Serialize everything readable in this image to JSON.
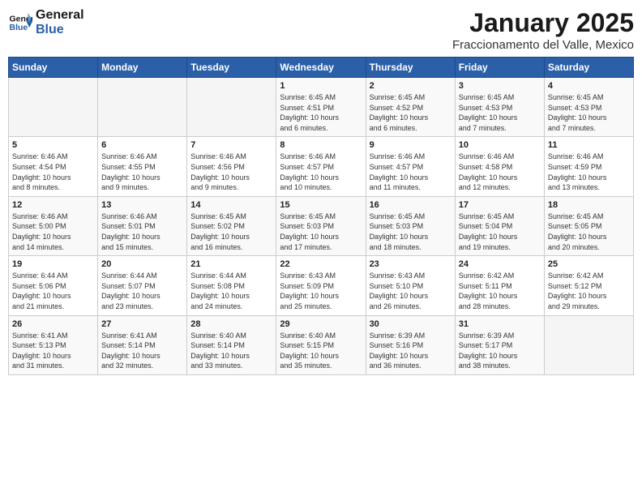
{
  "header": {
    "logo_line1": "General",
    "logo_line2": "Blue",
    "title": "January 2025",
    "subtitle": "Fraccionamento del Valle, Mexico"
  },
  "days_of_week": [
    "Sunday",
    "Monday",
    "Tuesday",
    "Wednesday",
    "Thursday",
    "Friday",
    "Saturday"
  ],
  "weeks": [
    [
      {
        "day": "",
        "info": ""
      },
      {
        "day": "",
        "info": ""
      },
      {
        "day": "",
        "info": ""
      },
      {
        "day": "1",
        "info": "Sunrise: 6:45 AM\nSunset: 4:51 PM\nDaylight: 10 hours\nand 6 minutes."
      },
      {
        "day": "2",
        "info": "Sunrise: 6:45 AM\nSunset: 4:52 PM\nDaylight: 10 hours\nand 6 minutes."
      },
      {
        "day": "3",
        "info": "Sunrise: 6:45 AM\nSunset: 4:53 PM\nDaylight: 10 hours\nand 7 minutes."
      },
      {
        "day": "4",
        "info": "Sunrise: 6:45 AM\nSunset: 4:53 PM\nDaylight: 10 hours\nand 7 minutes."
      }
    ],
    [
      {
        "day": "5",
        "info": "Sunrise: 6:46 AM\nSunset: 4:54 PM\nDaylight: 10 hours\nand 8 minutes."
      },
      {
        "day": "6",
        "info": "Sunrise: 6:46 AM\nSunset: 4:55 PM\nDaylight: 10 hours\nand 9 minutes."
      },
      {
        "day": "7",
        "info": "Sunrise: 6:46 AM\nSunset: 4:56 PM\nDaylight: 10 hours\nand 9 minutes."
      },
      {
        "day": "8",
        "info": "Sunrise: 6:46 AM\nSunset: 4:57 PM\nDaylight: 10 hours\nand 10 minutes."
      },
      {
        "day": "9",
        "info": "Sunrise: 6:46 AM\nSunset: 4:57 PM\nDaylight: 10 hours\nand 11 minutes."
      },
      {
        "day": "10",
        "info": "Sunrise: 6:46 AM\nSunset: 4:58 PM\nDaylight: 10 hours\nand 12 minutes."
      },
      {
        "day": "11",
        "info": "Sunrise: 6:46 AM\nSunset: 4:59 PM\nDaylight: 10 hours\nand 13 minutes."
      }
    ],
    [
      {
        "day": "12",
        "info": "Sunrise: 6:46 AM\nSunset: 5:00 PM\nDaylight: 10 hours\nand 14 minutes."
      },
      {
        "day": "13",
        "info": "Sunrise: 6:46 AM\nSunset: 5:01 PM\nDaylight: 10 hours\nand 15 minutes."
      },
      {
        "day": "14",
        "info": "Sunrise: 6:45 AM\nSunset: 5:02 PM\nDaylight: 10 hours\nand 16 minutes."
      },
      {
        "day": "15",
        "info": "Sunrise: 6:45 AM\nSunset: 5:03 PM\nDaylight: 10 hours\nand 17 minutes."
      },
      {
        "day": "16",
        "info": "Sunrise: 6:45 AM\nSunset: 5:03 PM\nDaylight: 10 hours\nand 18 minutes."
      },
      {
        "day": "17",
        "info": "Sunrise: 6:45 AM\nSunset: 5:04 PM\nDaylight: 10 hours\nand 19 minutes."
      },
      {
        "day": "18",
        "info": "Sunrise: 6:45 AM\nSunset: 5:05 PM\nDaylight: 10 hours\nand 20 minutes."
      }
    ],
    [
      {
        "day": "19",
        "info": "Sunrise: 6:44 AM\nSunset: 5:06 PM\nDaylight: 10 hours\nand 21 minutes."
      },
      {
        "day": "20",
        "info": "Sunrise: 6:44 AM\nSunset: 5:07 PM\nDaylight: 10 hours\nand 23 minutes."
      },
      {
        "day": "21",
        "info": "Sunrise: 6:44 AM\nSunset: 5:08 PM\nDaylight: 10 hours\nand 24 minutes."
      },
      {
        "day": "22",
        "info": "Sunrise: 6:43 AM\nSunset: 5:09 PM\nDaylight: 10 hours\nand 25 minutes."
      },
      {
        "day": "23",
        "info": "Sunrise: 6:43 AM\nSunset: 5:10 PM\nDaylight: 10 hours\nand 26 minutes."
      },
      {
        "day": "24",
        "info": "Sunrise: 6:42 AM\nSunset: 5:11 PM\nDaylight: 10 hours\nand 28 minutes."
      },
      {
        "day": "25",
        "info": "Sunrise: 6:42 AM\nSunset: 5:12 PM\nDaylight: 10 hours\nand 29 minutes."
      }
    ],
    [
      {
        "day": "26",
        "info": "Sunrise: 6:41 AM\nSunset: 5:13 PM\nDaylight: 10 hours\nand 31 minutes."
      },
      {
        "day": "27",
        "info": "Sunrise: 6:41 AM\nSunset: 5:14 PM\nDaylight: 10 hours\nand 32 minutes."
      },
      {
        "day": "28",
        "info": "Sunrise: 6:40 AM\nSunset: 5:14 PM\nDaylight: 10 hours\nand 33 minutes."
      },
      {
        "day": "29",
        "info": "Sunrise: 6:40 AM\nSunset: 5:15 PM\nDaylight: 10 hours\nand 35 minutes."
      },
      {
        "day": "30",
        "info": "Sunrise: 6:39 AM\nSunset: 5:16 PM\nDaylight: 10 hours\nand 36 minutes."
      },
      {
        "day": "31",
        "info": "Sunrise: 6:39 AM\nSunset: 5:17 PM\nDaylight: 10 hours\nand 38 minutes."
      },
      {
        "day": "",
        "info": ""
      }
    ]
  ]
}
